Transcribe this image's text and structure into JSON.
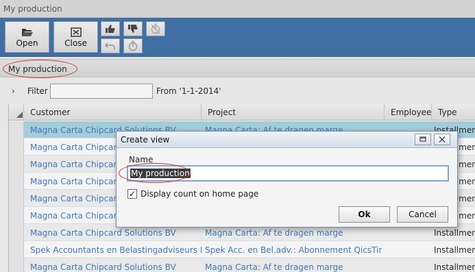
{
  "window": {
    "title": "My production"
  },
  "ribbon": {
    "open_label": "Open",
    "close_label": "Close",
    "small_buttons": [
      "thumbs-up-icon",
      "thumbs-down-icon",
      "timer-disabled-icon",
      "undo-icon",
      "timer-icon"
    ]
  },
  "view": {
    "title": "My production"
  },
  "filter": {
    "label": "Filter",
    "value": "",
    "from_label": "From '1-1-2014'"
  },
  "grid": {
    "columns": [
      "Customer",
      "Project",
      "Employee",
      "Type"
    ],
    "rows": [
      {
        "customer": "Magna Carta Chipcard Solutions BV",
        "project": "Magna Carta: Af te dragen marge",
        "employee": "",
        "type": "Installment"
      },
      {
        "customer": "Magna Carta Chipcard",
        "project": "",
        "employee": "",
        "type": "Installment"
      },
      {
        "customer": "Magna Carta Chipcard",
        "project": "",
        "employee": "",
        "type": "Installment"
      },
      {
        "customer": "Magna Carta Chipcard",
        "project": "",
        "employee": "",
        "type": "Installment"
      },
      {
        "customer": "Magna Carta Chipcard",
        "project": "",
        "employee": "",
        "type": "Installment"
      },
      {
        "customer": "Magna Carta Chipcard",
        "project": "",
        "employee": "",
        "type": "Installment"
      },
      {
        "customer": "Magna Carta Chipcard Solutions BV",
        "project": "Magna Carta: Af te dragen marge",
        "employee": "",
        "type": "Installment"
      },
      {
        "customer": "Spek Accountants en Belastingadviseurs BV",
        "project": "Spek Acc. en Bel.adv.: Abonnement QicsTime",
        "employee": "",
        "type": "Installment"
      },
      {
        "customer": "Magna Carta Chipcard Solutions BV",
        "project": "Magna Carta: Af te dragen marge",
        "employee": "",
        "type": "Installment"
      }
    ]
  },
  "dialog": {
    "title": "Create view",
    "name_label": "Name",
    "name_value": "My production",
    "checkbox_label": "Display count on home page",
    "checkbox_checked": true,
    "ok_label": "Ok",
    "cancel_label": "Cancel"
  },
  "colors": {
    "ribbon": "#3c6fa8",
    "link_text": "#3a7bbf",
    "selected_row": "#a9d4e4",
    "annotation": "#d32a2a"
  }
}
